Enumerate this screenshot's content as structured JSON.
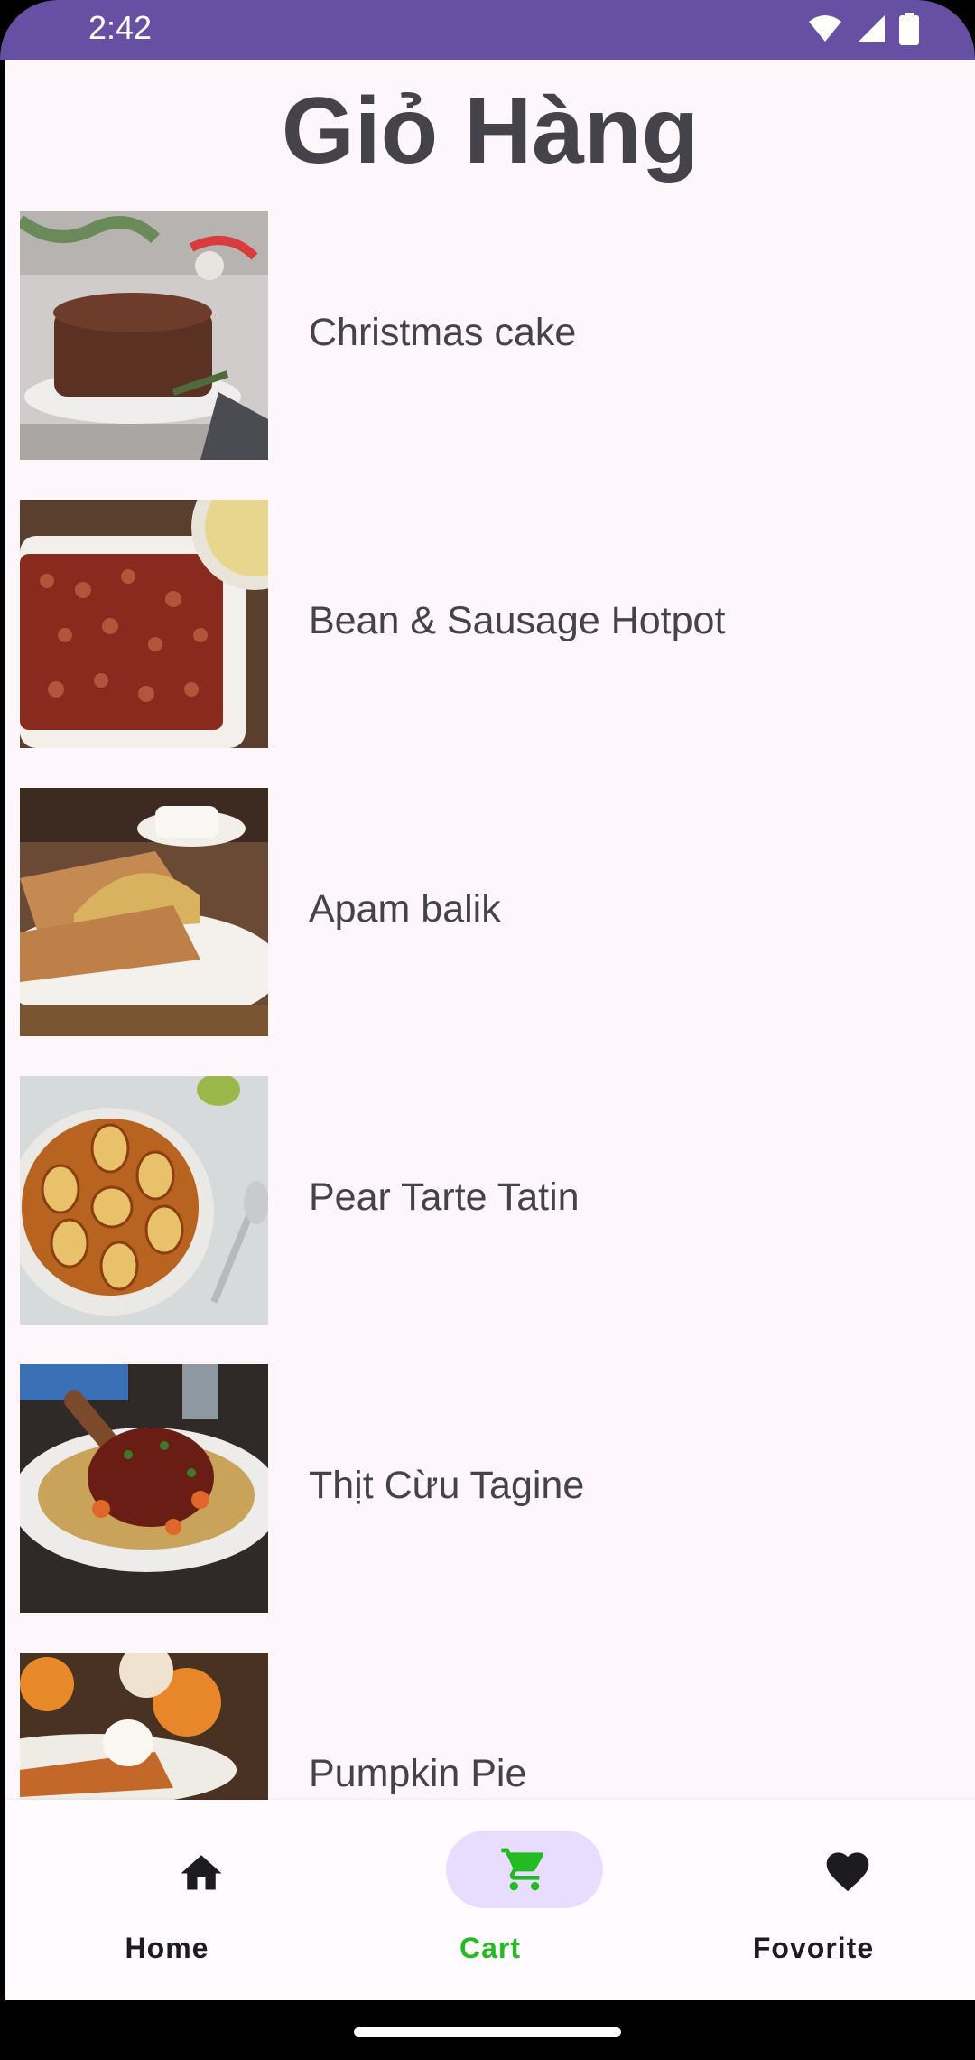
{
  "status": {
    "time": "2:42"
  },
  "page": {
    "title": "Giỏ Hàng"
  },
  "items": [
    {
      "name": "Christmas cake"
    },
    {
      "name": "Bean & Sausage Hotpot"
    },
    {
      "name": "Apam balik"
    },
    {
      "name": "Pear Tarte Tatin"
    },
    {
      "name": "Thịt Cừu Tagine"
    },
    {
      "name": "Pumpkin Pie"
    }
  ],
  "nav": {
    "home": {
      "label": "Home",
      "icon": "home-icon"
    },
    "cart": {
      "label": "Cart",
      "icon": "cart-icon",
      "active": true
    },
    "favorite": {
      "label": "Fovorite",
      "icon": "heart-icon"
    }
  },
  "colors": {
    "status_bar": "#6750a4",
    "background": "#fdf6fb",
    "active_pill": "#e9ddff",
    "active_label": "#22bb22"
  }
}
